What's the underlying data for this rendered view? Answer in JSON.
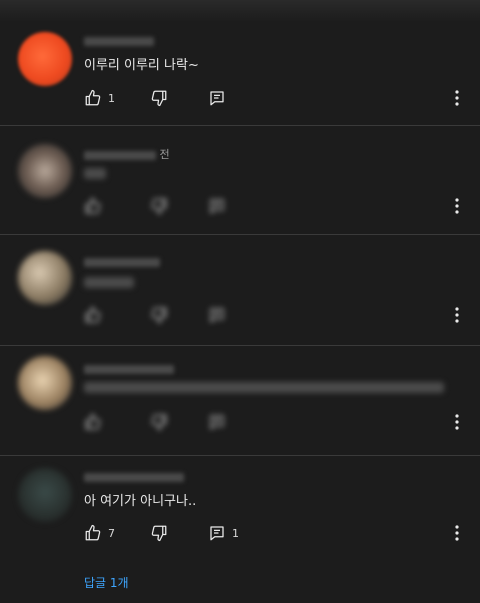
{
  "comments": [
    {
      "author": "",
      "time": "",
      "text": "이루리 이루리 나락~",
      "likes": "1",
      "replies": ""
    },
    {
      "author": "",
      "time": "전",
      "text": "",
      "likes": "",
      "replies": ""
    },
    {
      "author": "",
      "time": "",
      "text": "",
      "likes": "",
      "replies": ""
    },
    {
      "author": "",
      "time": "",
      "text": "",
      "likes": "",
      "replies": ""
    },
    {
      "author": "",
      "time": "",
      "text": "아 여기가 아니구나..",
      "likes": "7",
      "replies": "1"
    }
  ],
  "view_replies_label": "답글 1개",
  "colors": {
    "accent": "#3ea6ff",
    "background": "#1c1c1c",
    "divider": "#3a3a3a"
  },
  "icons": [
    "thumbs-up-icon",
    "thumbs-down-icon",
    "reply-icon",
    "more-vert-icon"
  ]
}
